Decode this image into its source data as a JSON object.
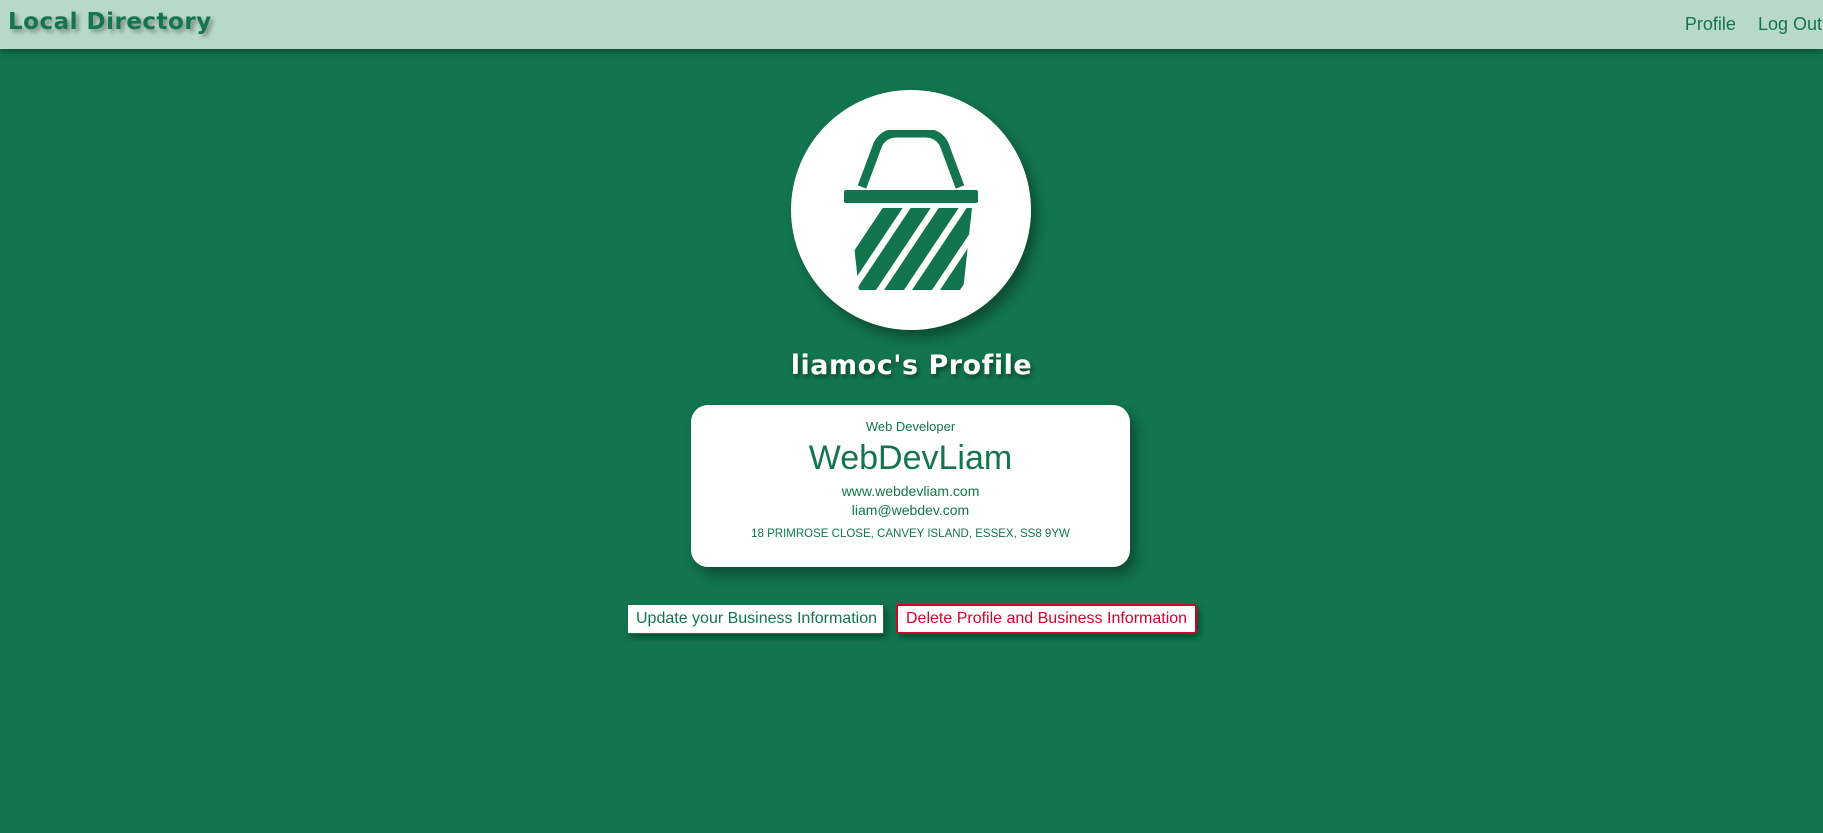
{
  "nav": {
    "brand": "Local Directory",
    "links": [
      {
        "label": "Profile"
      },
      {
        "label": "Log Out"
      }
    ]
  },
  "profile": {
    "avatar_icon": "shopping-basket-icon",
    "title": "liamoc's Profile"
  },
  "business": {
    "occupation": "Web Developer",
    "name": "WebDevLiam",
    "website": "www.webdevliam.com",
    "email": "liam@webdev.com",
    "address": "18 PRIMROSE CLOSE, CANVEY ISLAND, ESSEX, SS8 9YW"
  },
  "actions": {
    "update_label": "Update your Business Information",
    "delete_label": "Delete Profile and Business Information"
  },
  "colors": {
    "background": "#12754f",
    "navbar": "#b9d8cc",
    "accent": "#12754f",
    "danger": "#d6002b"
  }
}
